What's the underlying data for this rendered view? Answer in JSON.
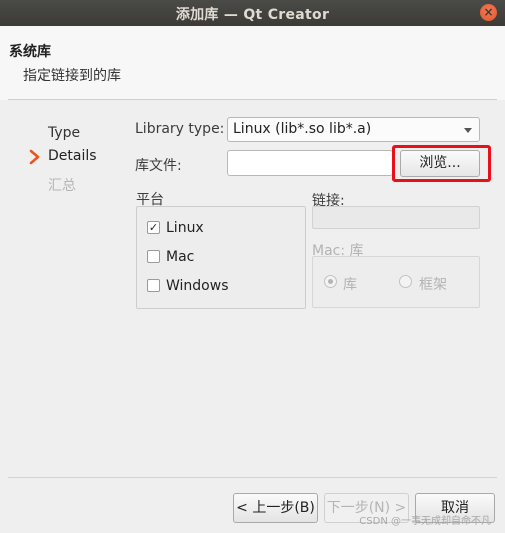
{
  "window": {
    "title": "添加库 — Qt Creator",
    "close_label": "×"
  },
  "header": {
    "title": "系统库",
    "subtitle": "指定链接到的库"
  },
  "steps": [
    {
      "label": "Type",
      "state": "done"
    },
    {
      "label": "Details",
      "state": "current"
    },
    {
      "label": "汇总",
      "state": "pending"
    }
  ],
  "form": {
    "library_type_label": "Library type:",
    "library_type_value": "Linux (lib*.so lib*.a)",
    "library_file_label": "库文件:",
    "library_file_value": "",
    "browse_label": "浏览...",
    "platform_label": "平台",
    "platforms": [
      {
        "label": "Linux",
        "checked": true,
        "mark": "✓"
      },
      {
        "label": "Mac",
        "checked": false,
        "mark": ""
      },
      {
        "label": "Windows",
        "checked": false,
        "mark": ""
      }
    ],
    "linkage_label": "链接:",
    "mac_label": "Mac: 库",
    "mac_options": [
      {
        "label": "库",
        "selected": true
      },
      {
        "label": "框架",
        "selected": false
      }
    ]
  },
  "buttons": {
    "back": "< 上一步(B)",
    "next": "下一步(N) >",
    "cancel": "取消"
  },
  "watermark": "CSDN @一事无成却自命不凡",
  "colors": {
    "highlight": "#e8101a",
    "accent_arrow": "#e95420"
  }
}
